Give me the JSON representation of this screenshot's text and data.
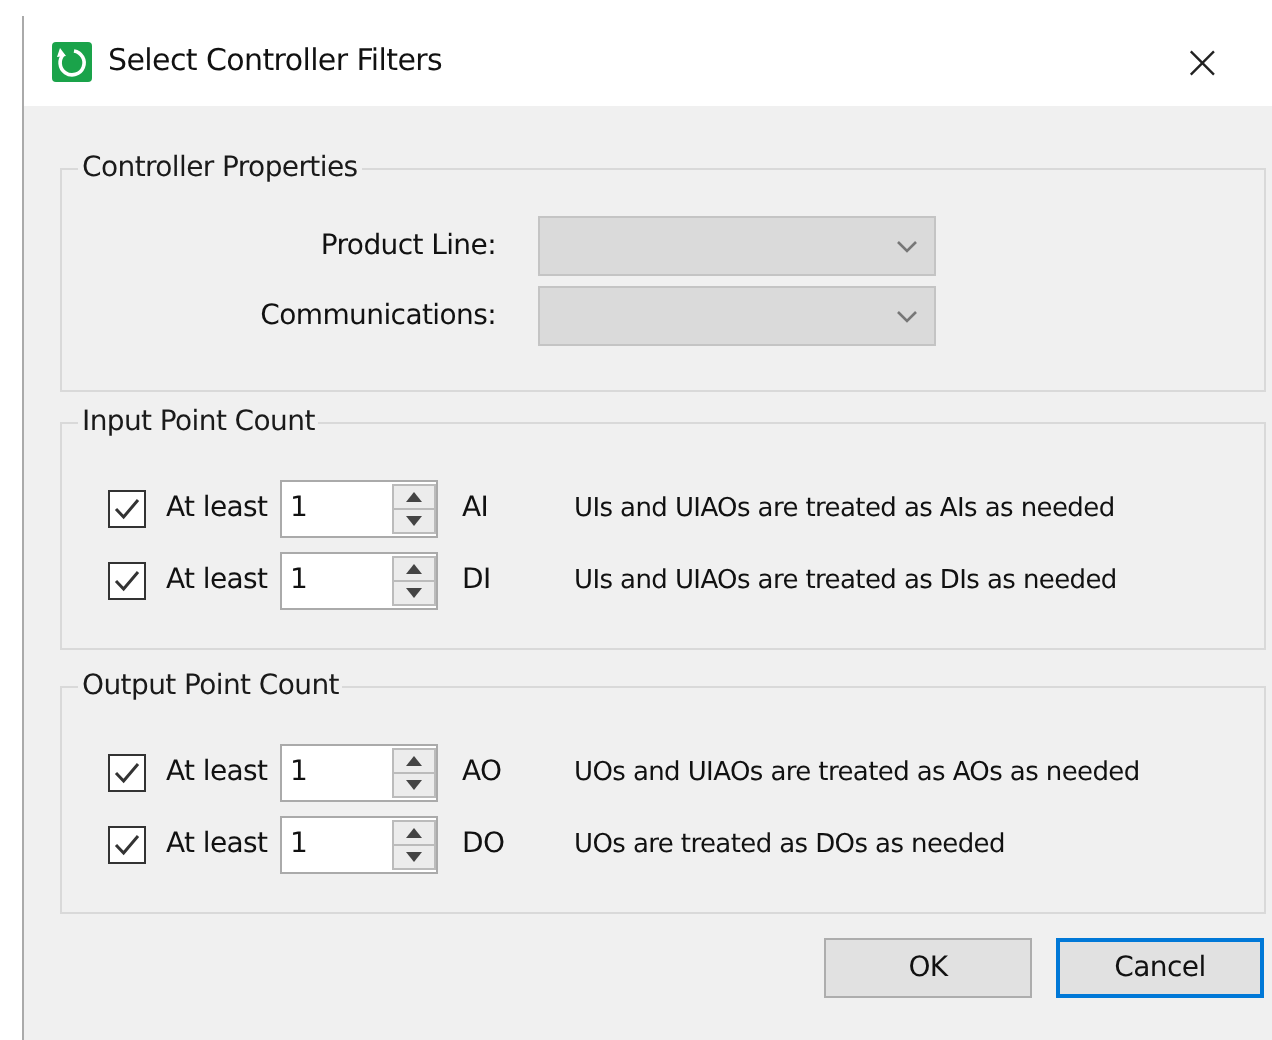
{
  "window": {
    "title": "Select Controller Filters",
    "close": "×"
  },
  "controller_properties": {
    "title": "Controller Properties",
    "fields": [
      {
        "label": "Product Line:",
        "disabled": true
      },
      {
        "label": "Communications:",
        "disabled": true
      }
    ]
  },
  "groups": [
    {
      "title": "Input Point Count",
      "rows": [
        {
          "checked": true,
          "label": "At least",
          "value": "1",
          "unit": "AI",
          "note": "UIs and UIAOs are treated as AIs as needed"
        },
        {
          "checked": true,
          "label": "At least",
          "value": "1",
          "unit": "DI",
          "note": "UIs and UIAOs are treated as DIs as needed"
        }
      ]
    },
    {
      "title": "Output Point Count",
      "rows": [
        {
          "checked": true,
          "label": "At least",
          "value": "1",
          "unit": "AO",
          "note": "UOs and UIAOs are treated as AOs as needed"
        },
        {
          "checked": true,
          "label": "At least",
          "value": "1",
          "unit": "DO",
          "note": "UOs are treated as DOs as needed"
        }
      ]
    }
  ],
  "buttons": [
    {
      "label": "OK",
      "selected": false
    },
    {
      "label": "Cancel",
      "selected": true
    }
  ]
}
